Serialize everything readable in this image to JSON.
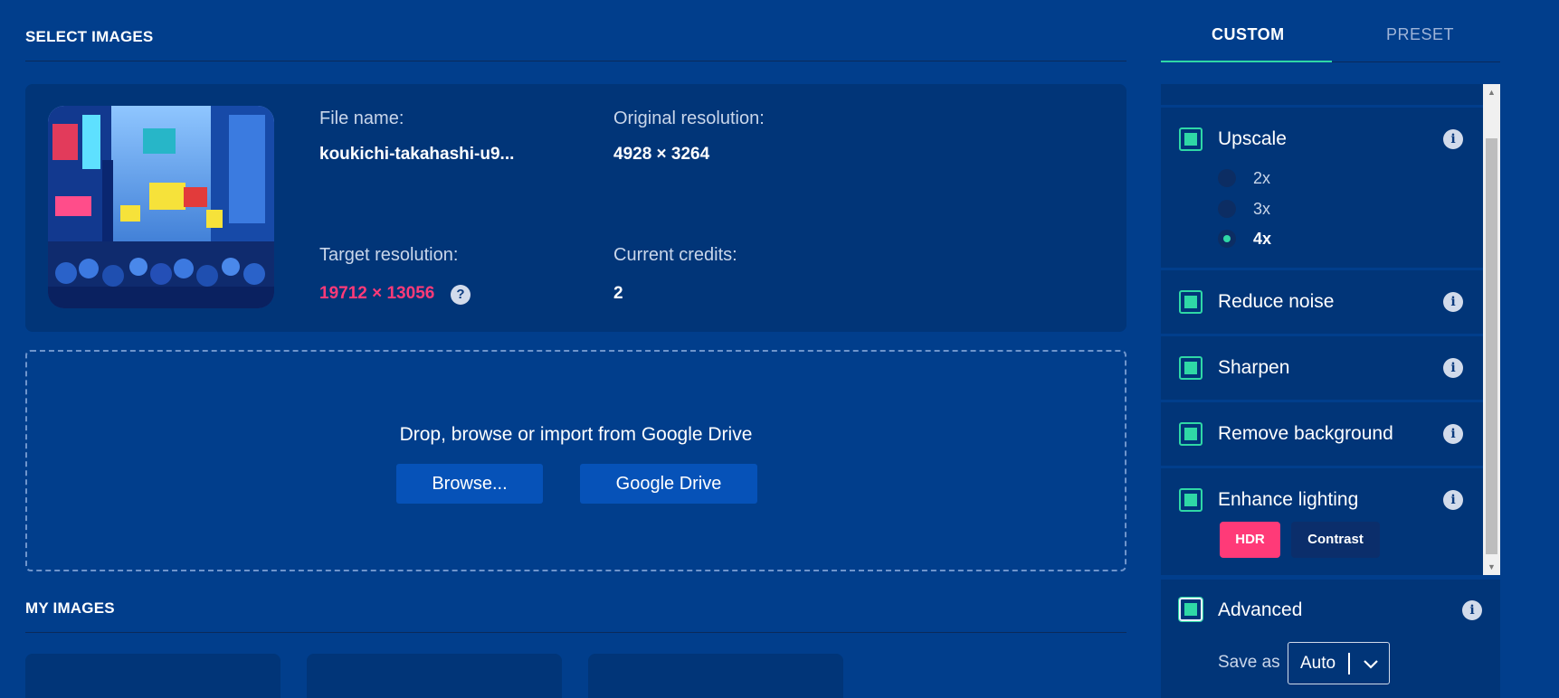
{
  "select_images": {
    "title": "SELECT IMAGES",
    "file": {
      "file_name_label": "File name:",
      "file_name": "koukichi-takahashi-u9...",
      "original_resolution_label": "Original resolution:",
      "original_resolution": "4928 × 3264",
      "target_resolution_label": "Target resolution:",
      "target_resolution": "19712 × 13056",
      "target_help": "?",
      "credits_label": "Current credits:",
      "credits": "2"
    },
    "dropzone": {
      "text": "Drop, browse or import from Google Drive",
      "browse_label": "Browse...",
      "drive_label": "Google Drive"
    }
  },
  "my_images": {
    "title": "MY IMAGES"
  },
  "tabs": [
    {
      "label": "CUSTOM",
      "active": true
    },
    {
      "label": "PRESET",
      "active": false
    }
  ],
  "options": {
    "upscale": {
      "label": "Upscale",
      "choices": [
        "2x",
        "3x",
        "4x"
      ],
      "selected": "4x"
    },
    "reduce_noise": {
      "label": "Reduce noise"
    },
    "sharpen": {
      "label": "Sharpen"
    },
    "remove_background": {
      "label": "Remove background"
    },
    "enhance_lighting": {
      "label": "Enhance lighting",
      "modes": [
        "HDR",
        "Contrast"
      ],
      "selected": "HDR"
    },
    "advanced": {
      "label": "Advanced",
      "save_as_label": "Save as",
      "save_as_value": "Auto"
    },
    "info_glyph": "i"
  },
  "colors": {
    "background": "#013e8c",
    "card": "#013578",
    "accent": "#2fd8a6",
    "highlight": "#ff3a78"
  }
}
